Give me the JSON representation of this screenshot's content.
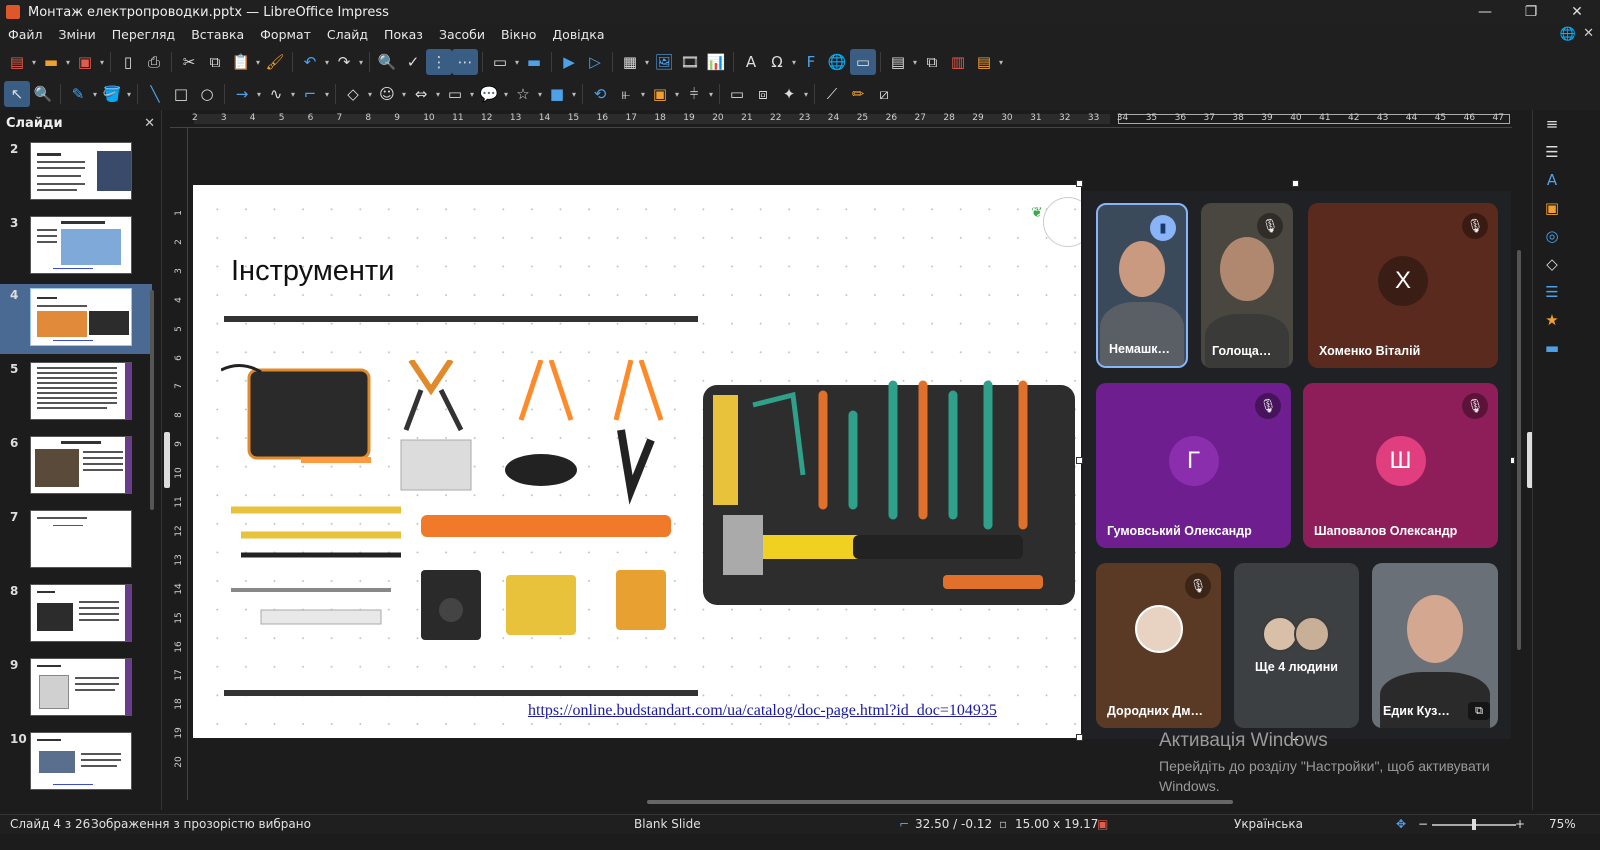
{
  "window": {
    "title": "Монтаж електропроводки.pptx — LibreOffice Impress",
    "controls": [
      "—",
      "❐",
      "✕"
    ]
  },
  "menu": [
    "Файл",
    "Зміни",
    "Перегляд",
    "Вставка",
    "Формат",
    "Слайд",
    "Показ",
    "Засоби",
    "Вікно",
    "Довідка"
  ],
  "slides_pane": {
    "title": "Слайди",
    "numbers": [
      "2",
      "3",
      "4",
      "5",
      "6",
      "7",
      "8",
      "9",
      "10"
    ],
    "current": "4"
  },
  "ruler": {
    "h_ticks": [
      "2",
      "3",
      "4",
      "5",
      "6",
      "7",
      "8",
      "9",
      "10",
      "11",
      "12",
      "13",
      "14",
      "15",
      "16",
      "17",
      "18",
      "19",
      "20",
      "21",
      "22",
      "23",
      "24",
      "25",
      "26",
      "27",
      "28",
      "29",
      "30",
      "31",
      "32",
      "33",
      "34",
      "35",
      "36",
      "37",
      "38",
      "39",
      "40",
      "41",
      "42",
      "43",
      "44",
      "45",
      "46",
      "47"
    ],
    "v_ticks": [
      "1",
      "2",
      "3",
      "4",
      "5",
      "6",
      "7",
      "8",
      "9",
      "10",
      "11",
      "12",
      "13",
      "14",
      "15",
      "16",
      "17",
      "18",
      "19",
      "20"
    ]
  },
  "slide": {
    "title": "Інструменти",
    "link": "https://online.budstandart.com/ua/catalog/doc-page.html?id_doc=104935"
  },
  "meeting": {
    "tiles": [
      {
        "name": "Немашк…",
        "initial": "",
        "color": "#3a4a5a",
        "mic": "talk"
      },
      {
        "name": "Голоща…",
        "initial": "",
        "color": "#4a4640",
        "mic": "muted"
      },
      {
        "name": "Хоменко Віталій",
        "initial": "Х",
        "color": "#5a2a1e",
        "mic": "muted"
      },
      {
        "name": "Гумовський Олександр",
        "initial": "Г",
        "color": "#6e1e8e",
        "mic": "muted"
      },
      {
        "name": "Шаповалов Олександр",
        "initial": "Ш",
        "color": "#8e1e5a",
        "mic": "muted"
      },
      {
        "name": "Дородних Дм…",
        "initial": "",
        "color": "#5a3a24",
        "mic": "muted"
      },
      {
        "name": "Ще 4 людини",
        "initial": "",
        "color": "#3c4043",
        "mic": ""
      },
      {
        "name": "Едик Куз…",
        "initial": "",
        "color": "#6a7078",
        "mic": ""
      }
    ]
  },
  "watermark": {
    "title": "Активація Windows",
    "line1": "Перейдіть до розділу \"Настройки\", щоб активувати",
    "line2": "Windows."
  },
  "status": {
    "slide_pos": "Слайд 4 з 26",
    "selection": "Зображення з прозорістю вибрано",
    "layout": "Blank Slide",
    "position": "32.50 / -0.12",
    "size": "15.00 x 19.17",
    "language": "Українська",
    "zoom": "75%"
  },
  "colors": {
    "accent": "#4ea1e8",
    "current_slide": "#4a6a94",
    "link": "#1a1aa6"
  }
}
